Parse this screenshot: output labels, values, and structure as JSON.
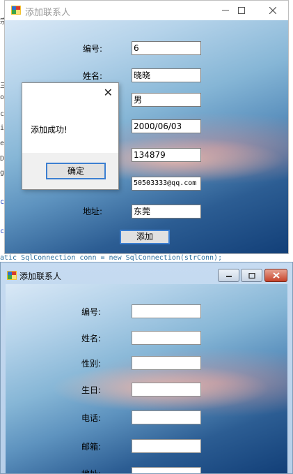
{
  "window1": {
    "title": "添加联系人",
    "labels": {
      "id": "编号:",
      "name": "姓名:",
      "address": "地址:"
    },
    "fields": {
      "id": "6",
      "name": "晓晓",
      "gender": "男",
      "birthday": "2000/06/03",
      "phone": "134879",
      "email": "50503333@qq.com",
      "address": "东莞"
    },
    "add_button": "添加"
  },
  "message_box": {
    "message": "添加成功!",
    "ok_button": "确定"
  },
  "window2": {
    "title": "添加联系人",
    "labels": {
      "id": "编号:",
      "name": "姓名:",
      "gender": "性别:",
      "birthday": "生日:",
      "phone": "电话:",
      "email": "邮箱:",
      "address": "地址:"
    },
    "fields": {
      "id": "",
      "name": "",
      "gender": "",
      "birthday": "",
      "phone": "",
      "email": "",
      "address": ""
    }
  },
  "background_code": {
    "left_chars": [
      "宗",
      "三",
      "o",
      "c",
      "i",
      "e",
      "D",
      "g",
      "c",
      "c"
    ],
    "bottom_line": "atic    SqlConnection conn = new SqlConnection(strConn);"
  },
  "icons": [
    "app-icon",
    "minimize-icon",
    "maximize-icon",
    "close-icon"
  ]
}
